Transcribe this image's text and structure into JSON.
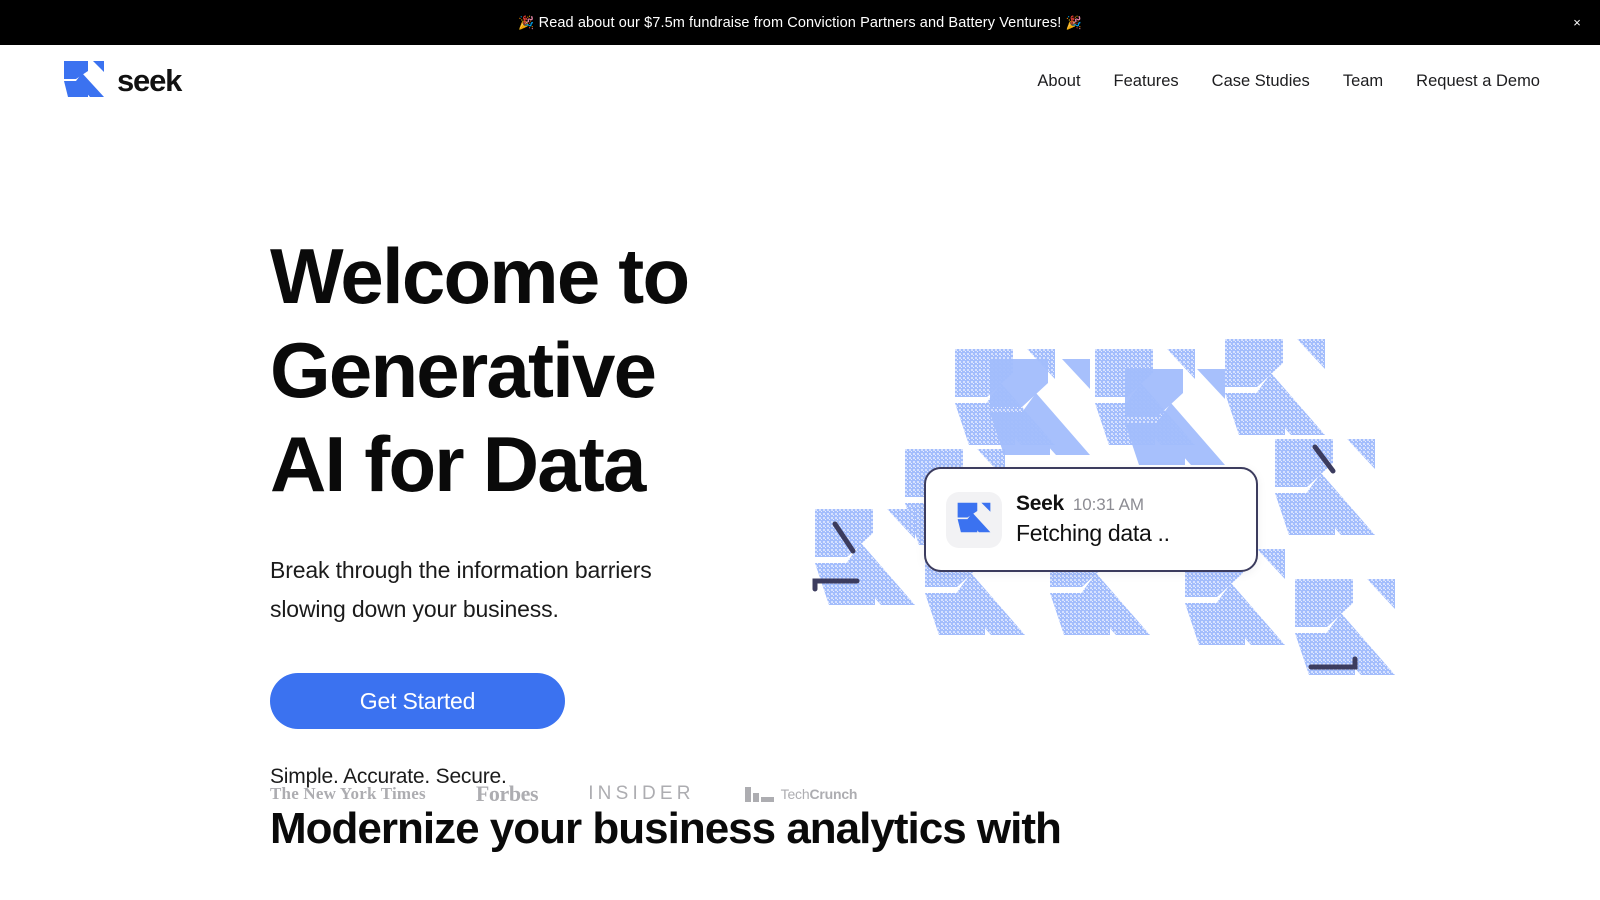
{
  "banner": {
    "emoji_left": "🎉",
    "text": "Read about our $7.5m fundraise from Conviction Partners and Battery Ventures!",
    "emoji_right": "🎉",
    "close_label": "×",
    "background": "#000000",
    "text_color": "#ffffff"
  },
  "header": {
    "brand": {
      "wordmark": "seek",
      "logo_icon": "seek-logo-icon",
      "logo_color": "#3b72f0"
    },
    "nav": [
      {
        "label": "About"
      },
      {
        "label": "Features"
      },
      {
        "label": "Case Studies"
      },
      {
        "label": "Team"
      },
      {
        "label": "Request a Demo"
      }
    ]
  },
  "hero": {
    "title": "Welcome to Generative AI for Data",
    "subtitle": "Break through the information barriers slowing down your business.",
    "cta_label": "Get Started",
    "cta_color": "#3b72f0",
    "press_logos": [
      {
        "name": "the-new-york-times",
        "label": "The New York Times"
      },
      {
        "name": "forbes",
        "label": "Forbes"
      },
      {
        "name": "insider",
        "label": "INSIDER"
      },
      {
        "name": "techcrunch",
        "label_bold": "Tech",
        "label_light": "Crunch"
      }
    ],
    "notification": {
      "app_name": "Seek",
      "time": "10:31 AM",
      "message": "Fetching data ..",
      "border_color": "#3c3c5e",
      "avatar_icon": "seek-logo-icon"
    },
    "artwork": {
      "pattern_color": "#a3bdfc",
      "accent_color": "#3c3c5e"
    }
  },
  "section_two": {
    "eyebrow": "Simple. Accurate. Secure.",
    "heading": "Modernize your business analytics with"
  }
}
